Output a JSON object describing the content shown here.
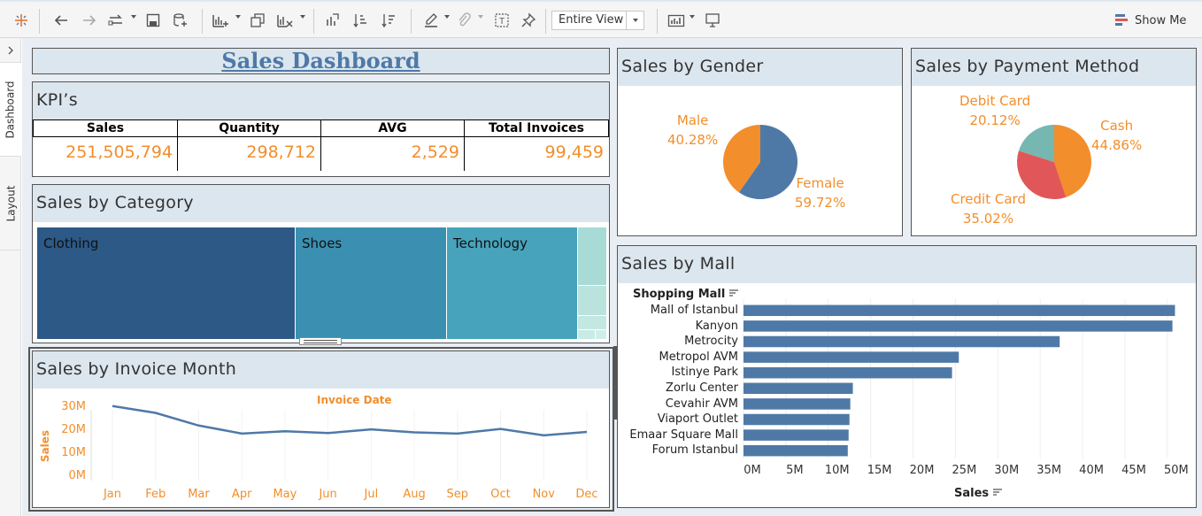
{
  "toolbar": {
    "view": "Entire View",
    "show_me": "Show Me"
  },
  "sidebar": {
    "tabs": [
      "Dashboard",
      "Layout"
    ]
  },
  "title": "Sales Dashboard",
  "kpi": {
    "title": "KPI’s",
    "headers": [
      "Sales",
      "Quantity",
      "AVG",
      "Total Invoices"
    ],
    "values": [
      "251,505,794",
      "298,712",
      "2,529",
      "99,459"
    ]
  },
  "category": {
    "title": "Sales by Category",
    "items": [
      "Clothing",
      "Shoes",
      "Technology"
    ]
  },
  "gender": {
    "title": "Sales by Gender",
    "male": {
      "label": "Male",
      "pct": "40.28%"
    },
    "female": {
      "label": "Female",
      "pct": "59.72%"
    }
  },
  "payment": {
    "title": "Sales by Payment Method",
    "debit": {
      "label": "Debit Card",
      "pct": "20.12%"
    },
    "cash": {
      "label": "Cash",
      "pct": "44.86%"
    },
    "credit": {
      "label": "Credit Card",
      "pct": "35.02%"
    }
  },
  "mall": {
    "title": "Sales by Mall",
    "header": "Shopping Mall",
    "xlabel": "Sales"
  },
  "month": {
    "title": "Sales by Invoice Month",
    "header": "Invoice Date",
    "ylabel": "Sales"
  },
  "colors": {
    "primary": "#4e79a7",
    "accent": "#f28e2b",
    "header_bg": "#dce6ee",
    "red": "#e15759",
    "teal": "#76b7b2"
  },
  "chart_data": [
    {
      "type": "pie",
      "title": "Sales by Gender",
      "categories": [
        "Male",
        "Female"
      ],
      "values": [
        40.28,
        59.72
      ]
    },
    {
      "type": "pie",
      "title": "Sales by Payment Method",
      "categories": [
        "Cash",
        "Credit Card",
        "Debit Card"
      ],
      "values": [
        44.86,
        35.02,
        20.12
      ]
    },
    {
      "type": "bar",
      "title": "Sales by Mall",
      "categories": [
        "Mall of Istanbul",
        "Kanyon",
        "Metrocity",
        "Metropol AVM",
        "Istinye Park",
        "Zorlu Center",
        "Cevahir AVM",
        "Viaport Outlet",
        "Emaar Square Mall",
        "Forum Istanbul"
      ],
      "values": [
        50900000,
        50600000,
        37300000,
        25400000,
        24600000,
        12900000,
        12600000,
        12500000,
        12400000,
        12300000
      ],
      "xlabel": "Sales",
      "xticks": [
        "0M",
        "5M",
        "10M",
        "15M",
        "20M",
        "25M",
        "30M",
        "35M",
        "40M",
        "45M",
        "50M"
      ],
      "xlim": [
        0,
        52000000
      ]
    },
    {
      "type": "line",
      "title": "Sales by Invoice Month",
      "x": [
        "Jan",
        "Feb",
        "Mar",
        "Apr",
        "May",
        "Jun",
        "Jul",
        "Aug",
        "Sep",
        "Oct",
        "Nov",
        "Dec"
      ],
      "values": [
        31000000,
        28000000,
        22500000,
        19000000,
        20000000,
        19200000,
        20800000,
        19500000,
        19000000,
        21000000,
        18200000,
        19700000
      ],
      "xlabel": "Invoice Date",
      "ylabel": "Sales",
      "yticks": [
        "0M",
        "10M",
        "20M",
        "30M"
      ],
      "ylim": [
        0,
        34000000
      ]
    },
    {
      "type": "treemap",
      "title": "Sales by Category",
      "categories": [
        "Clothing",
        "Shoes",
        "Technology"
      ]
    }
  ]
}
